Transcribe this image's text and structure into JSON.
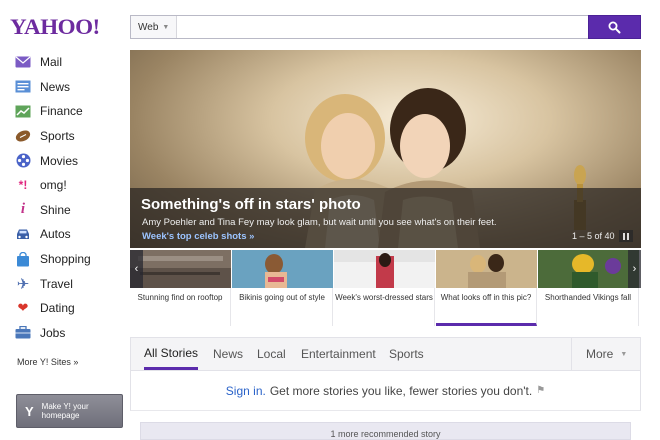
{
  "logo": "YAHOO!",
  "search": {
    "scope": "Web",
    "value": "",
    "placeholder": ""
  },
  "colors": {
    "brand_purple": "#5b2bac",
    "link_blue": "#2b63c9"
  },
  "sidebar": {
    "items": [
      {
        "label": "Mail",
        "icon": "mail-icon"
      },
      {
        "label": "News",
        "icon": "news-icon"
      },
      {
        "label": "Finance",
        "icon": "finance-icon"
      },
      {
        "label": "Sports",
        "icon": "football-icon"
      },
      {
        "label": "Movies",
        "icon": "film-reel-icon"
      },
      {
        "label": "omg!",
        "icon": "omg-icon"
      },
      {
        "label": "Shine",
        "icon": "shine-icon"
      },
      {
        "label": "Autos",
        "icon": "car-icon"
      },
      {
        "label": "Shopping",
        "icon": "shopping-bag-icon"
      },
      {
        "label": "Travel",
        "icon": "plane-icon"
      },
      {
        "label": "Dating",
        "icon": "hearts-icon"
      },
      {
        "label": "Jobs",
        "icon": "briefcase-icon"
      }
    ],
    "more_sites": "More Y! Sites »",
    "make_homepage": "Make Y! your homepage"
  },
  "hero": {
    "title": "Something's off in stars' photo",
    "summary": "Amy Poehler and Tina Fey may look glam, but wait until you see what's on their feet.",
    "link": "Week's top celeb shots »",
    "counter": "1 – 5 of 40"
  },
  "thumbnails": [
    {
      "label": "Stunning find on rooftop"
    },
    {
      "label": "Bikinis going out of style"
    },
    {
      "label": "Week's worst-dressed stars"
    },
    {
      "label": "What looks off in this pic?"
    },
    {
      "label": "Shorthanded Vikings fall"
    }
  ],
  "tabs": [
    {
      "label": "All Stories"
    },
    {
      "label": "News"
    },
    {
      "label": "Local"
    },
    {
      "label": "Entertainment"
    },
    {
      "label": "Sports"
    }
  ],
  "tab_more": "More",
  "signin": {
    "link": "Sign in.",
    "text": "Get more stories you like, fewer stories you don't."
  },
  "recommend": "1 more recommended story"
}
